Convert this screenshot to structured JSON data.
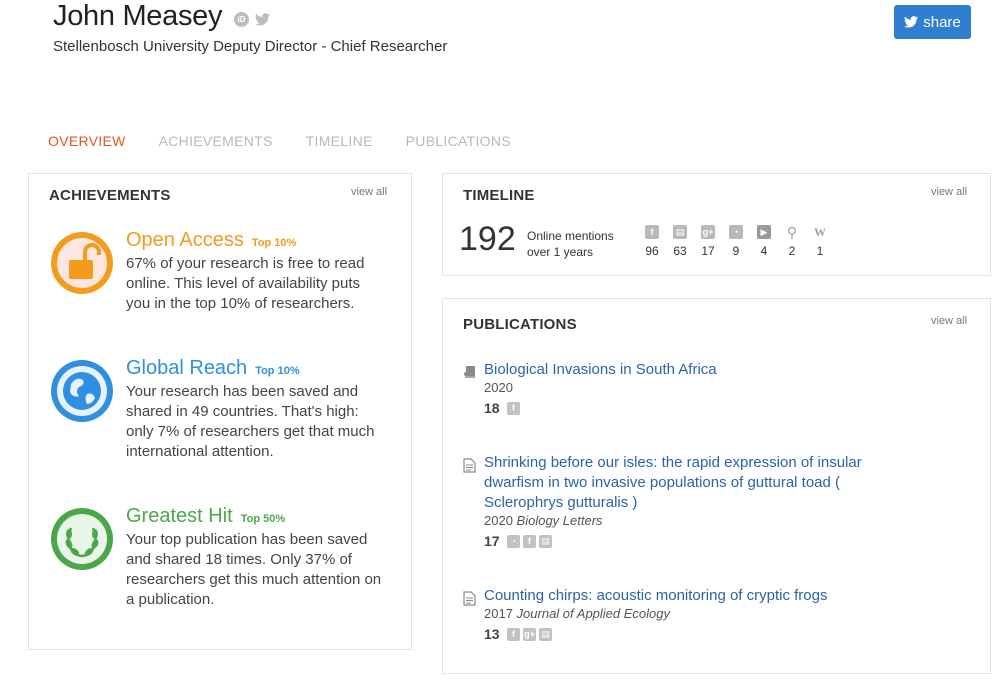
{
  "header": {
    "name": "John Measey",
    "subtitle": "Stellenbosch University Deputy Director - Chief Researcher",
    "share_label": "share"
  },
  "tabs": [
    {
      "label": "OVERVIEW"
    },
    {
      "label": "ACHIEVEMENTS"
    },
    {
      "label": "TIMELINE"
    },
    {
      "label": "PUBLICATIONS"
    }
  ],
  "achievements": {
    "title": "ACHIEVEMENTS",
    "view_all": "view all",
    "items": [
      {
        "title": "Open Access",
        "rank": "Top 10%",
        "description": "67% of your research is free to read online. This level of availability puts you in the top 10% of researchers.",
        "color": "#f39b1d"
      },
      {
        "title": "Global Reach",
        "rank": "Top 10%",
        "description": "Your research has been saved and shared in 49 countries. That's high: only 7% of researchers get that much international attention.",
        "color": "#2f8fe0"
      },
      {
        "title": "Greatest Hit",
        "rank": "Top 50%",
        "description": "Your top publication has been saved and shared 18 times. Only 37% of researchers get this much attention on a publication.",
        "color": "#4aa84a"
      }
    ]
  },
  "timeline": {
    "title": "TIMELINE",
    "view_all": "view all",
    "count": "192",
    "label_line1": "Online mentions",
    "label_line2": "over 1 years",
    "sources": [
      {
        "icon": "facebook-icon",
        "glyph": "f",
        "value": "96"
      },
      {
        "icon": "news-icon",
        "glyph": "▤",
        "value": "63"
      },
      {
        "icon": "googleplus-icon",
        "glyph": "g+",
        "value": "17"
      },
      {
        "icon": "rss-icon",
        "glyph": "◔",
        "value": "9"
      },
      {
        "icon": "video-icon",
        "glyph": "▶",
        "value": "4"
      },
      {
        "icon": "search-icon",
        "glyph": "⚲",
        "value": "2"
      },
      {
        "icon": "wikipedia-icon",
        "glyph": "W",
        "value": "1"
      }
    ]
  },
  "publications": {
    "title": "PUBLICATIONS",
    "view_all": "view all",
    "items": [
      {
        "title": "Biological Invasions in South Africa",
        "year": "2020",
        "journal": "",
        "count": "18",
        "sources": [
          "facebook-icon"
        ]
      },
      {
        "title": "Shrinking before our isles: the rapid expression of insular dwarfism in two invasive populations of guttural toad ( Sclerophrys gutturalis )",
        "year": "2020",
        "journal": "Biology Letters",
        "count": "17",
        "sources": [
          "rss-icon",
          "facebook-icon",
          "news-icon"
        ]
      },
      {
        "title": "Counting chirps: acoustic monitoring of cryptic frogs",
        "year": "2017",
        "journal": "Journal of Applied Ecology",
        "count": "13",
        "sources": [
          "facebook-icon",
          "googleplus-icon",
          "news-icon"
        ]
      }
    ]
  }
}
